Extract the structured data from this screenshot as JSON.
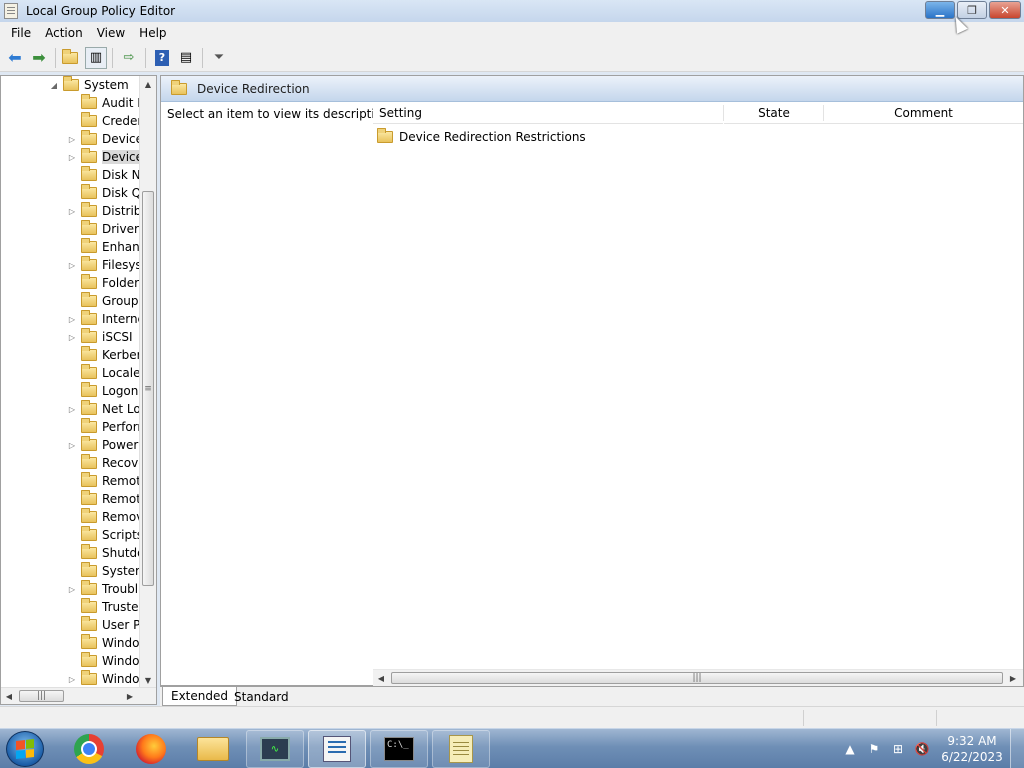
{
  "window": {
    "title": "Local Group Policy Editor"
  },
  "menu": {
    "items": [
      "File",
      "Action",
      "View",
      "Help"
    ]
  },
  "toolbar": {
    "buttons": [
      "back-icon",
      "forward-icon",
      "up-folder-icon",
      "show-hide-tree-icon",
      "export-list-icon",
      "help-icon",
      "properties-icon",
      "filter-icon"
    ]
  },
  "tree": {
    "root": {
      "label": "System",
      "expanded": true
    },
    "items": [
      {
        "label": "Audit P",
        "expandable": false
      },
      {
        "label": "Creden",
        "expandable": false
      },
      {
        "label": "Device",
        "expandable": true
      },
      {
        "label": "Device",
        "expandable": true,
        "selected": true
      },
      {
        "label": "Disk N",
        "expandable": false
      },
      {
        "label": "Disk Q",
        "expandable": false
      },
      {
        "label": "Distrib",
        "expandable": true
      },
      {
        "label": "Driver I",
        "expandable": false
      },
      {
        "label": "Enhanc",
        "expandable": false
      },
      {
        "label": "Filesyst",
        "expandable": true
      },
      {
        "label": "Folder",
        "expandable": false
      },
      {
        "label": "Group",
        "expandable": false
      },
      {
        "label": "Interne",
        "expandable": true
      },
      {
        "label": "iSCSI",
        "expandable": true
      },
      {
        "label": "Kerber",
        "expandable": false
      },
      {
        "label": "Locale",
        "expandable": false
      },
      {
        "label": "Logon",
        "expandable": false
      },
      {
        "label": "Net Lo",
        "expandable": true
      },
      {
        "label": "Perforn",
        "expandable": false
      },
      {
        "label": "Power",
        "expandable": true
      },
      {
        "label": "Recove",
        "expandable": false
      },
      {
        "label": "Remot",
        "expandable": false
      },
      {
        "label": "Remot",
        "expandable": false
      },
      {
        "label": "Remov",
        "expandable": false
      },
      {
        "label": "Scripts",
        "expandable": false
      },
      {
        "label": "Shutdo",
        "expandable": false
      },
      {
        "label": "System",
        "expandable": false
      },
      {
        "label": "Troubl",
        "expandable": true
      },
      {
        "label": "Trustec",
        "expandable": false
      },
      {
        "label": "User Pr",
        "expandable": false
      },
      {
        "label": "Windo",
        "expandable": false
      },
      {
        "label": "Windo",
        "expandable": false
      },
      {
        "label": "Windo",
        "expandable": true
      }
    ]
  },
  "details": {
    "header": "Device Redirection",
    "description": "Select an item to view its description.",
    "columns": [
      "Setting",
      "State",
      "Comment"
    ],
    "rows": [
      {
        "setting": "Device Redirection Restrictions",
        "state": "",
        "comment": ""
      }
    ]
  },
  "tabs": [
    {
      "label": "Extended",
      "active": true
    },
    {
      "label": "Standard",
      "active": false
    }
  ],
  "taskbar": {
    "apps": [
      "chrome-icon",
      "firefox-icon",
      "file-explorer-icon",
      "monitor-icon",
      "group-policy-editor-icon",
      "command-prompt-icon",
      "notepad-icon"
    ],
    "active_app": "group-policy-editor-icon",
    "clock_time": "9:32 AM",
    "clock_date": "6/22/2023"
  }
}
